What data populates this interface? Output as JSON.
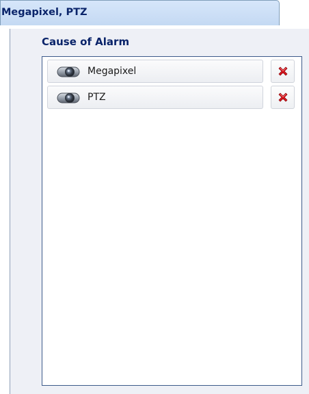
{
  "tab": {
    "title": "Megapixel, PTZ"
  },
  "section": {
    "label": "Cause of Alarm"
  },
  "list": {
    "items": [
      {
        "label": "Megapixel",
        "icon": "camera-icon"
      },
      {
        "label": "PTZ",
        "icon": "camera-icon"
      }
    ],
    "remove_icon": "delete-x-icon"
  },
  "colors": {
    "title_text": "#0a246a",
    "tab_bg": "#c4d9f3",
    "panel_bg": "#eef0f6",
    "list_border": "#3c5a8a",
    "remove_red": "#d8161e"
  }
}
